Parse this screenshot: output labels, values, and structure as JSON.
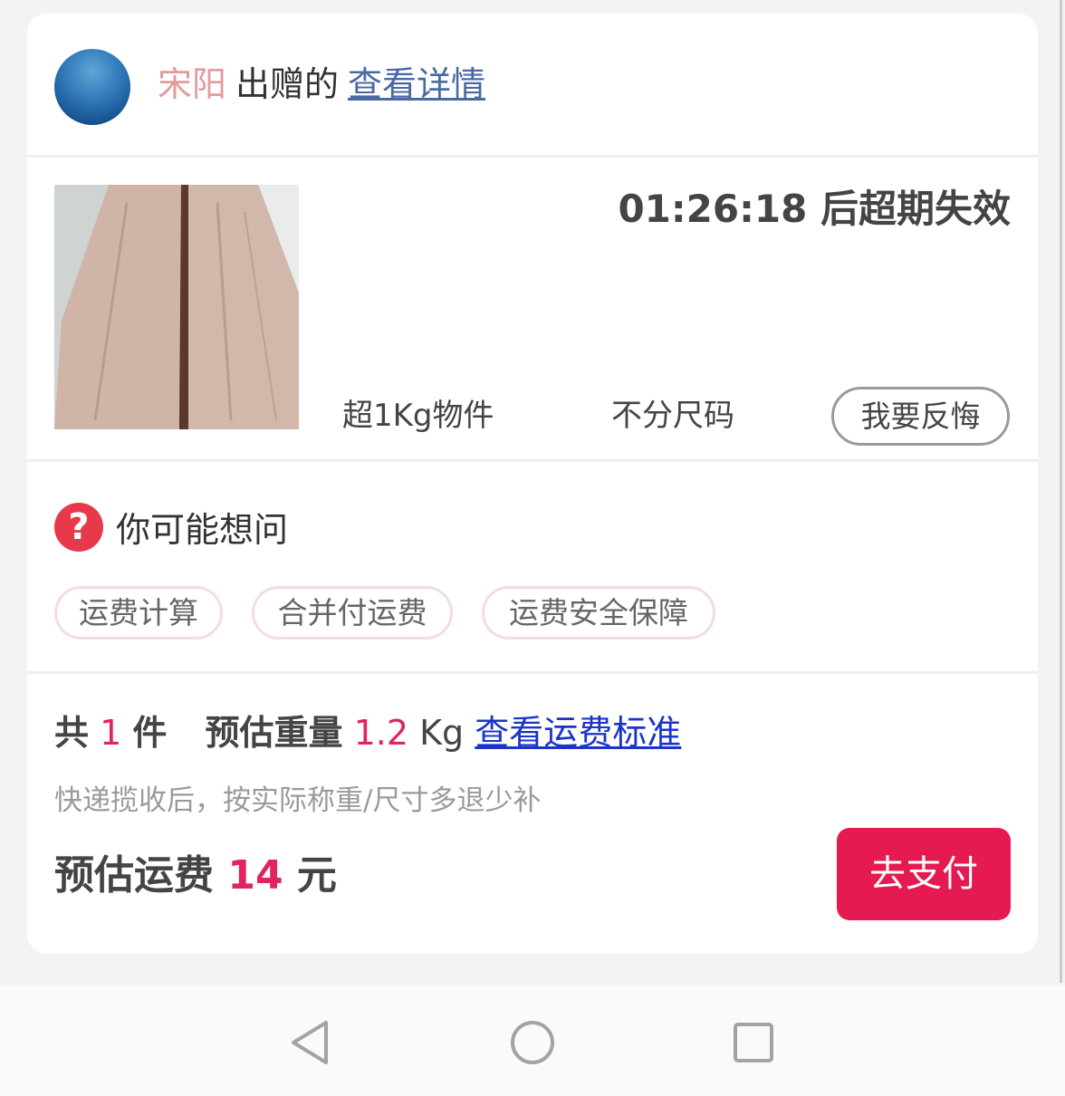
{
  "header": {
    "giver_name": "宋阳",
    "gave_text": "出赠的",
    "detail_link": "查看详情"
  },
  "item": {
    "countdown": "01:26:18 后超期失效",
    "weight_tag": "超1Kg物件",
    "size_tag": "不分尺码",
    "regret_button": "我要反悔"
  },
  "faq": {
    "title": "你可能想问",
    "chips": [
      "运费计算",
      "合并付运费",
      "运费安全保障"
    ]
  },
  "summary": {
    "total_label": "共",
    "count": "1",
    "count_unit": "件",
    "weight_label": "预估重量",
    "weight_value": "1.2",
    "weight_unit": "Kg",
    "standard_link": "查看运费标准",
    "note": "快递揽收后，按实际称重/尺寸多退少补",
    "fee_label": "预估运费",
    "fee_value": "14",
    "fee_unit": "元",
    "pay_button": "去支付"
  },
  "colors": {
    "accent": "#e0245e",
    "pay_button": "#e51a51",
    "link_blue": "#1a35c8",
    "giver_pink": "#e59a9a"
  },
  "icons": {
    "question": "question-circle-icon",
    "nav_back": "triangle-back-icon",
    "nav_home": "circle-home-icon",
    "nav_recent": "square-recent-icon"
  }
}
